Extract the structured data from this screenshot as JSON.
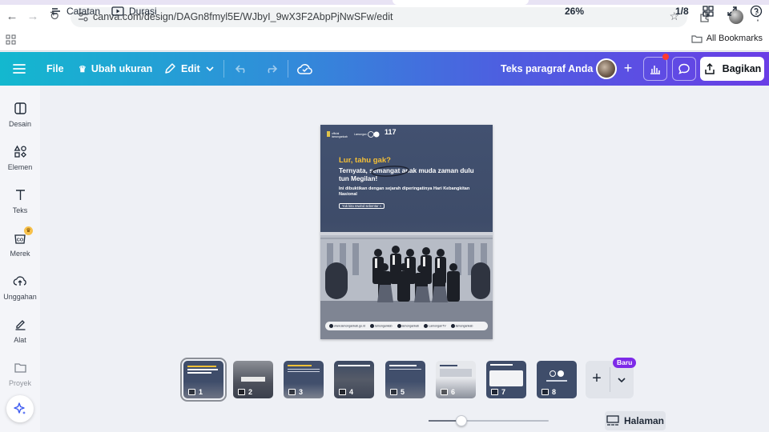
{
  "browser": {
    "url": "canva.com/design/DAGn8fmyl5E/WJbyI_9wX3F2AbpPjNwSFw/edit",
    "bookmarks_label": "All Bookmarks"
  },
  "header": {
    "file_label": "File",
    "resize_label": "Ubah ukuran",
    "edit_label": "Edit",
    "doc_title": "Teks paragraf Anda",
    "share_label": "Bagikan",
    "colors": {
      "gradient_start": "#13b8cf",
      "gradient_end": "#6a3ee6",
      "notification_dot": "#ff3b30"
    }
  },
  "sidebar": {
    "items": [
      {
        "label": "Desain",
        "icon": "layout-icon"
      },
      {
        "label": "Elemen",
        "icon": "shapes-icon"
      },
      {
        "label": "Teks",
        "icon": "text-icon"
      },
      {
        "label": "Merek",
        "icon": "brand-icon"
      },
      {
        "label": "Unggahan",
        "icon": "cloud-upload-icon"
      },
      {
        "label": "Alat",
        "icon": "pen-tool-icon"
      },
      {
        "label": "Proyek",
        "icon": "folder-icon"
      }
    ]
  },
  "design": {
    "logo_badge": "117",
    "eyebrow": "Lur, tahu gak?",
    "headline": "Ternyata, semangat anak muda zaman dulu tun Megilan!",
    "subtext": "Ini dibuktikan dengan sejarah diperingatinya Hari Kebangkitan Nasional",
    "pill": "Yuk kita rewind sebentar »",
    "footer": [
      "www.lamongankab.go.id",
      "lamongankab",
      "lamongankab",
      "LamonganTV",
      "lamongankab"
    ],
    "colors": {
      "background": "#3e4c69",
      "eyebrow": "#f5c036"
    }
  },
  "pages": {
    "numbers": [
      "1",
      "2",
      "3",
      "4",
      "5",
      "6",
      "7",
      "8"
    ],
    "new_badge": "Baru"
  },
  "bottom": {
    "notes_label": "Catatan",
    "duration_label": "Durasi",
    "zoom": "26%",
    "zoom_fraction": 0.27,
    "pages_label": "Halaman",
    "page_count": "1/8"
  }
}
